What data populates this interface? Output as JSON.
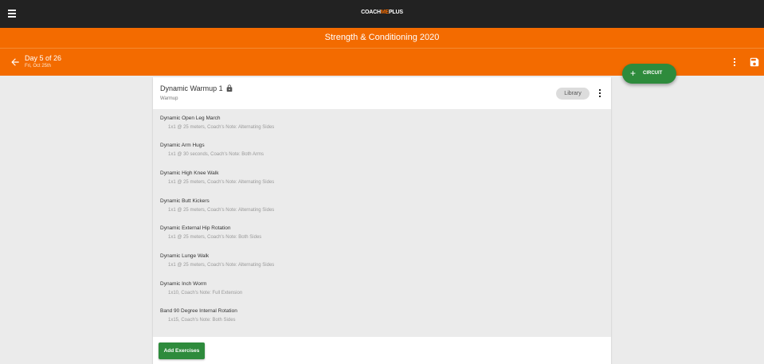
{
  "topbar": {
    "logo_part1": "COACH",
    "logo_part2": "ME",
    "logo_part3": "PLUS",
    "menu_icon": "hamburger-icon"
  },
  "program": {
    "title": "Strength & Conditioning 2020"
  },
  "day_bar": {
    "day_label": "Day 5 of 26",
    "date_label": "Fri, Oct 25th",
    "back_icon": "arrow-left-icon",
    "more_icon": "more-vert-icon",
    "save_icon": "floppy-disk-icon"
  },
  "circuit_button": {
    "label": "CIRCUIT",
    "icon": "plus-icon"
  },
  "block": {
    "title": "Dynamic Warmup 1",
    "subtitle": "Warmup",
    "lock_icon": "lock-icon",
    "library_label": "Library",
    "more_icon": "more-vert-icon",
    "exercises": [
      {
        "name": "Dynamic Open Leg March",
        "detail": "1x1 @ 25 meters, Coach's Note: Alternating Sides"
      },
      {
        "name": "Dynamic Arm Hugs",
        "detail": "1x1 @ 30 seconds, Coach's Note: Both Arms"
      },
      {
        "name": "Dynamic High Knee Walk",
        "detail": "1x1 @ 25 meters, Coach's Note: Alternating Sides"
      },
      {
        "name": "Dynamic Butt Kickers",
        "detail": "1x1 @ 25 meters, Coach's Note: Alternating Sides"
      },
      {
        "name": "Dynamic External Hip Rotation",
        "detail": "1x1 @ 25 meters, Coach's Note: Both Sides"
      },
      {
        "name": "Dynamic Lunge Walk",
        "detail": "1x1 @ 25 meters, Coach's Note: Alternating Sides"
      },
      {
        "name": "Dynamic Inch Worm",
        "detail": "1x10, Coach's Note: Full Extension"
      },
      {
        "name": "Band 90 Degree Internal Rotation",
        "detail": "1x15, Coach's Note: Both Sides"
      }
    ],
    "add_button_label": "Add Exercises"
  },
  "colors": {
    "topbar": "#222222",
    "accent_orange": "#f36b00",
    "action_green": "#2e8b3c",
    "background": "#ebebeb"
  }
}
